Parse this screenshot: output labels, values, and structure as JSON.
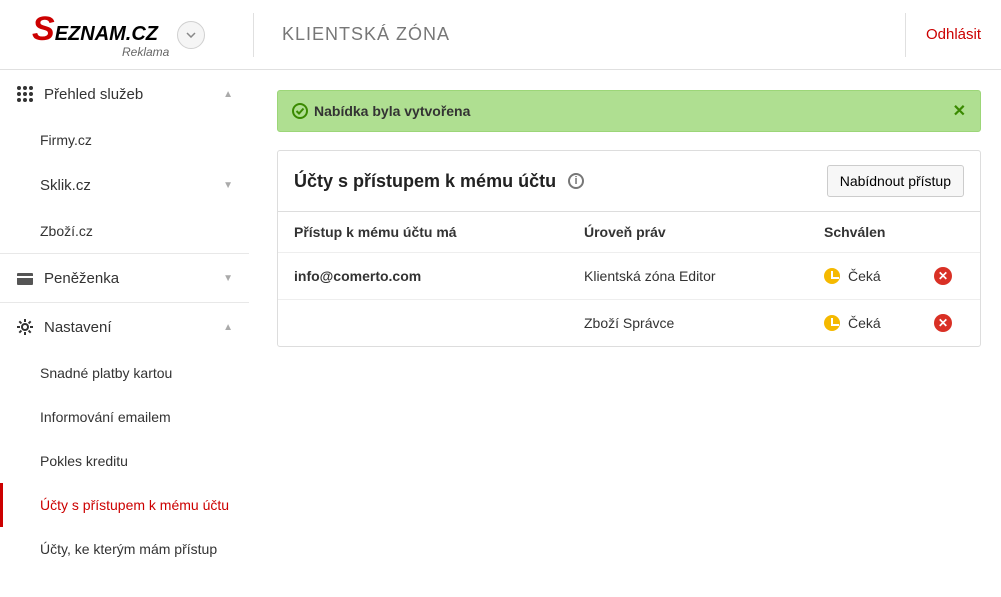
{
  "header": {
    "logo_main": "S",
    "logo_rest": "EZNAM.CZ",
    "logo_sub": "Reklama",
    "title": "KLIENTSKÁ ZÓNA",
    "logout": "Odhlásit"
  },
  "sidebar": {
    "overview": "Přehled služeb",
    "firmy": "Firmy.cz",
    "sklik": "Sklik.cz",
    "zbozi": "Zboží.cz",
    "wallet": "Peněženka",
    "settings": "Nastavení",
    "sub": {
      "card": "Snadné platby kartou",
      "email": "Informování emailem",
      "credit": "Pokles kreditu",
      "access_to_me": "Účty s přístupem k mému účtu",
      "my_access": "Účty, ke kterým mám přístup"
    }
  },
  "alert": {
    "text": "Nabídka byla vytvořena"
  },
  "panel": {
    "title": "Účty s přístupem k mému účtu",
    "button": "Nabídnout přístup",
    "cols": {
      "c1": "Přístup k mému účtu má",
      "c2": "Úroveň práv",
      "c3": "Schválen"
    },
    "rows": [
      {
        "email": "info@comerto.com",
        "level": "Klientská zóna Editor",
        "status": "Čeká"
      },
      {
        "email": "",
        "level": "Zboží Správce",
        "status": "Čeká"
      }
    ]
  }
}
